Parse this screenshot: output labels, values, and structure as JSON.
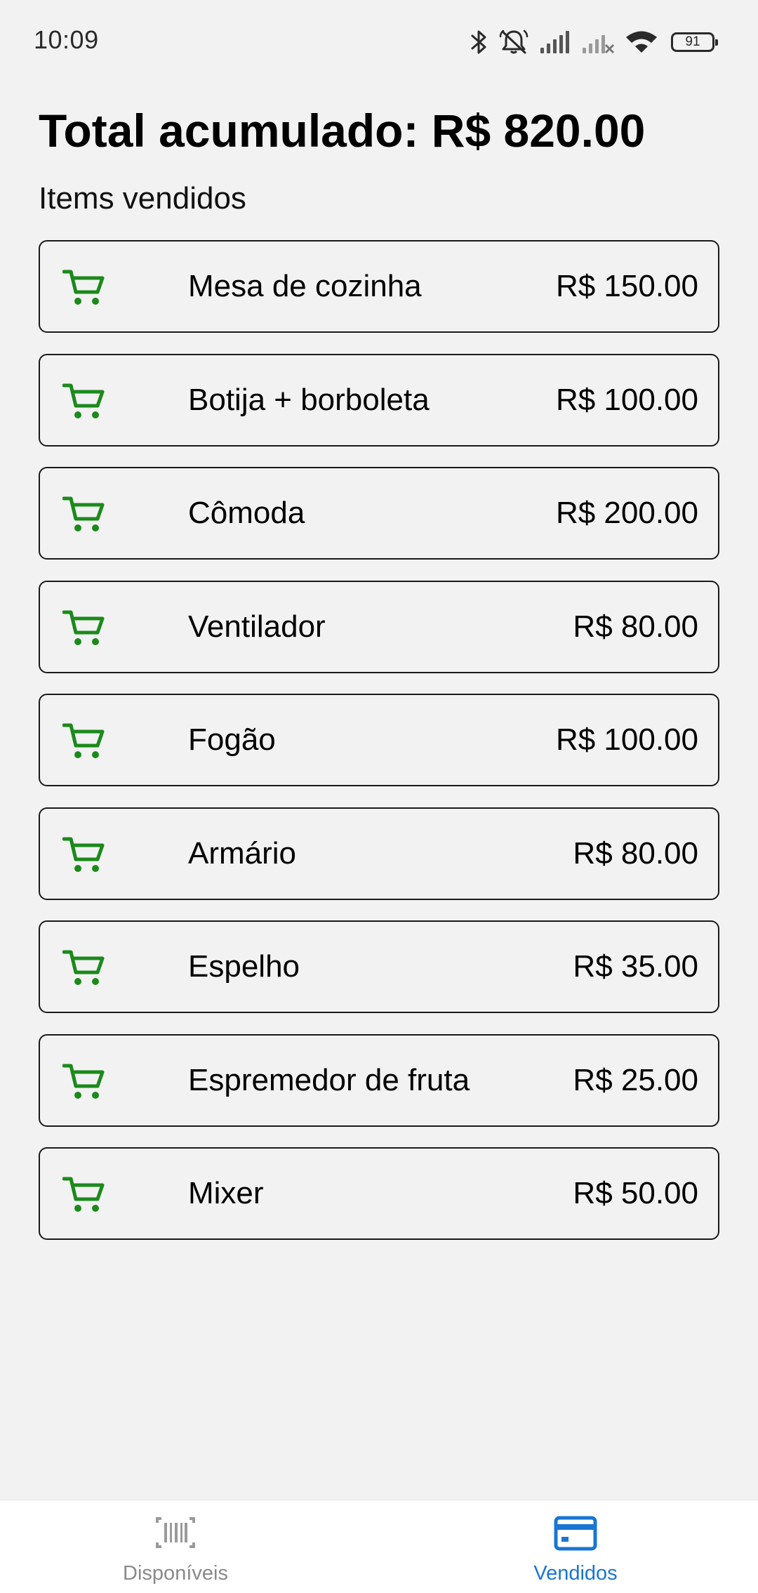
{
  "status_bar": {
    "time": "10:09",
    "battery_level": "91",
    "icons": [
      "bluetooth-icon",
      "bell-off-icon",
      "signal-icon",
      "signal-no-service-icon",
      "wifi-icon",
      "battery-icon"
    ]
  },
  "header": {
    "total_label": "Total acumulado: R$ 820.00",
    "section_label": "Items vendidos"
  },
  "colors": {
    "cart_icon": "#1b8a1b",
    "active_tab": "#1976d2",
    "inactive_tab": "#8a8a8a",
    "card_border": "#1a1a1a",
    "background": "#f2f2f2"
  },
  "items": [
    {
      "icon": "cart-icon",
      "name": "Mesa de cozinha",
      "price": "R$ 150.00"
    },
    {
      "icon": "cart-icon",
      "name": "Botija + borboleta",
      "price": "R$ 100.00"
    },
    {
      "icon": "cart-icon",
      "name": "Cômoda",
      "price": "R$ 200.00"
    },
    {
      "icon": "cart-icon",
      "name": "Ventilador",
      "price": "R$ 80.00"
    },
    {
      "icon": "cart-icon",
      "name": "Fogão",
      "price": "R$ 100.00"
    },
    {
      "icon": "cart-icon",
      "name": "Armário",
      "price": "R$ 80.00"
    },
    {
      "icon": "cart-icon",
      "name": "Espelho",
      "price": "R$ 35.00"
    },
    {
      "icon": "cart-icon",
      "name": "Espremedor de fruta",
      "price": "R$ 25.00"
    },
    {
      "icon": "cart-icon",
      "name": "Mixer",
      "price": "R$ 50.00"
    }
  ],
  "bottom_nav": {
    "tabs": [
      {
        "label": "Disponíveis",
        "icon": "barcode-icon",
        "active": false
      },
      {
        "label": "Vendidos",
        "icon": "credit-card-icon",
        "active": true
      }
    ]
  }
}
